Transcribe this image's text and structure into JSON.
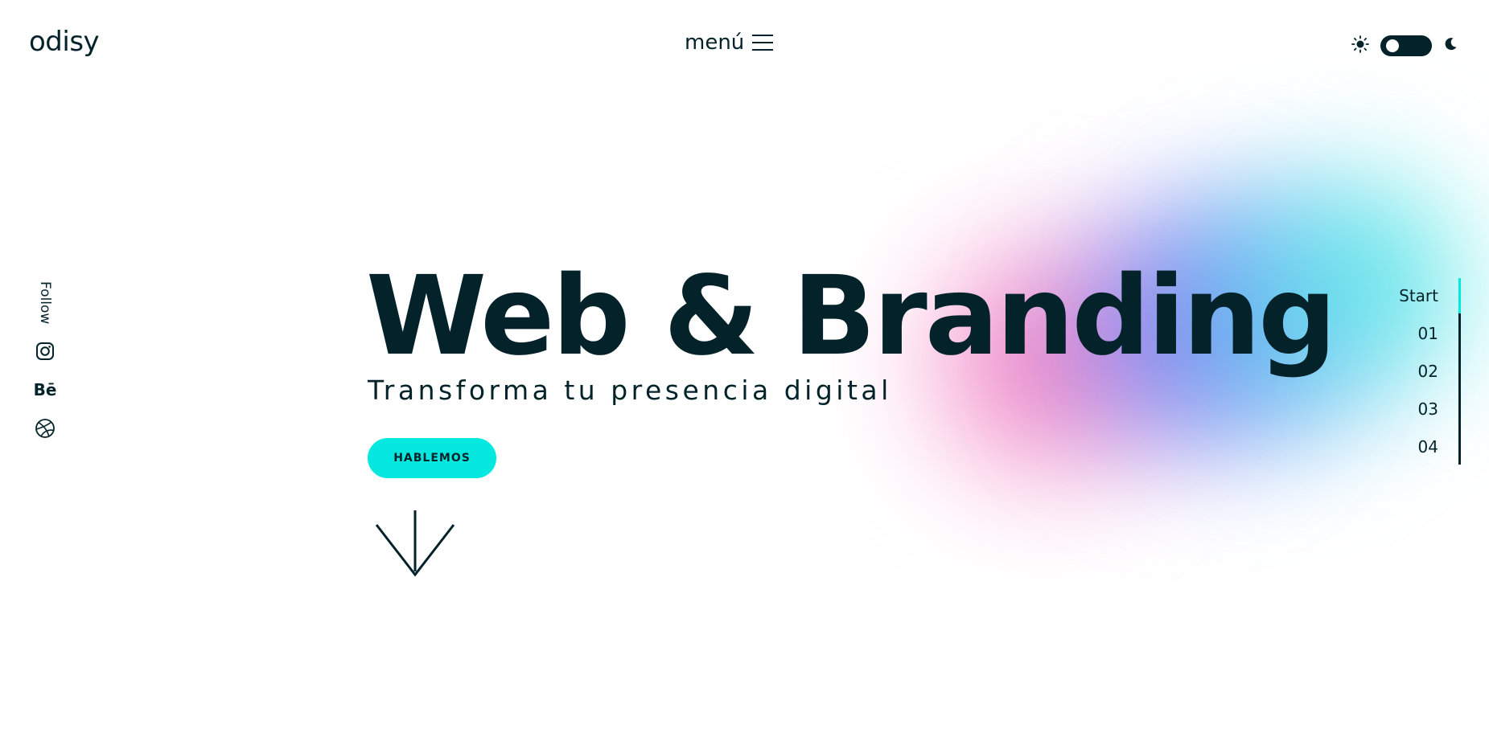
{
  "brand": {
    "logo": "odisy"
  },
  "header": {
    "menu_label": "menú",
    "theme_light_icon": "sun-icon",
    "theme_dark_icon": "moon-icon"
  },
  "follow": {
    "label": "Follow",
    "socials": [
      {
        "name": "instagram",
        "icon": "instagram-icon"
      },
      {
        "name": "behance",
        "label": "Bē",
        "icon": "behance-icon"
      },
      {
        "name": "dribbble",
        "icon": "dribbble-icon"
      }
    ]
  },
  "hero": {
    "title": "Web & Branding",
    "subtitle": "Transforma tu presencia digital",
    "cta_label": "HABLEMOS",
    "scroll_icon": "arrow-down-icon"
  },
  "side_nav": {
    "items": [
      "Start",
      "01",
      "02",
      "03",
      "04"
    ],
    "active": "Start"
  },
  "colors": {
    "ink": "#04222a",
    "accent": "#05e8e0",
    "gradient": [
      "#ec50aa",
      "#7850e6",
      "#3ca0f0",
      "#3ce6e1"
    ]
  }
}
